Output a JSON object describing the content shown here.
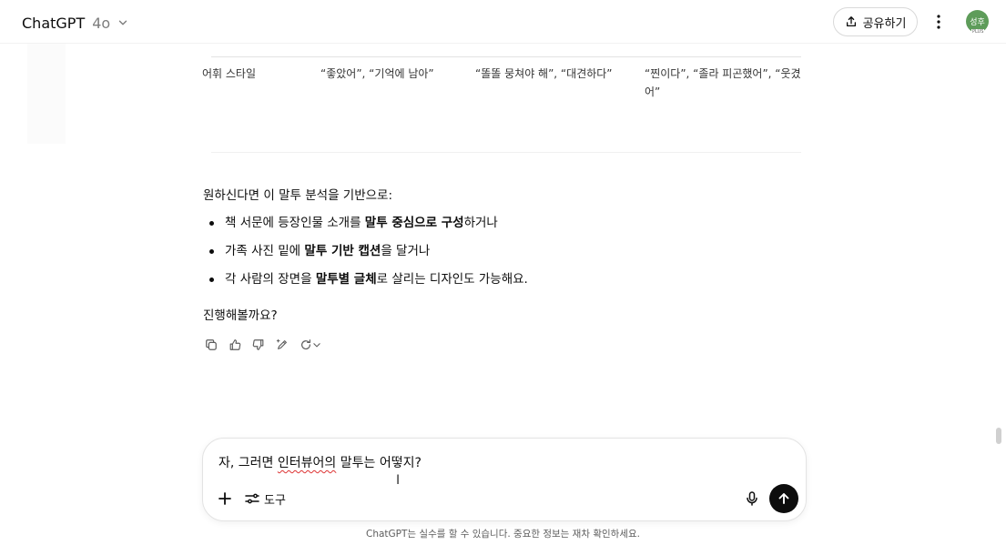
{
  "header": {
    "model_name": "ChatGPT",
    "model_version": "4o",
    "share_label": "공유하기",
    "avatar_text": "성후",
    "avatar_badge": "PLUS"
  },
  "table": {
    "row_header": "어휘 스타일",
    "cells": [
      "“좋았어”, “기억에 남아”",
      "“똘똘 뭉쳐야 해”, “대견하다”",
      "“찐이다”, “졸라 피곤했어”, “웃겼어”"
    ]
  },
  "message": {
    "intro": "원하신다면 이 말투 분석을 기반으로:",
    "bullets": [
      {
        "pre": "책 서문에 등장인물 소개를 ",
        "bold": "말투 중심으로 구성",
        "post": "하거나"
      },
      {
        "pre": "가족 사진 밑에 ",
        "bold": "말투 기반 캡션",
        "post": "을 달거나"
      },
      {
        "pre": "각 사람의 장면을 ",
        "bold": "말투별 글체",
        "post": "로 살리는 디자인도 가능해요."
      }
    ],
    "question": "진행해볼까요?"
  },
  "composer": {
    "text_pre": "자, 그러면 ",
    "text_error": "인터뷰어의",
    "text_post": " 말투는 어떻지?",
    "tools_label": "도구"
  },
  "footer": {
    "disclaimer": "ChatGPT는 실수를 할 수 있습니다. 중요한 정보는 재차 확인하세요."
  }
}
